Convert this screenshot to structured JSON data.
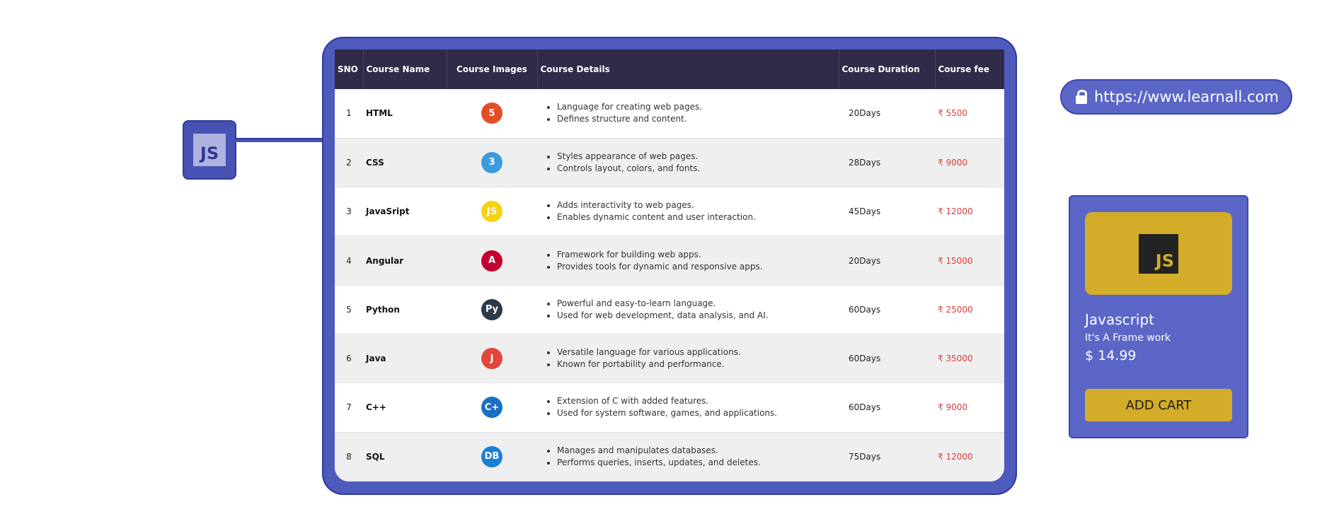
{
  "badge": {
    "label": "JS"
  },
  "table": {
    "headers": [
      "SNO",
      "Course Name",
      "Course Images",
      "Course Details",
      "Course Duration",
      "Course fee"
    ],
    "rows": [
      {
        "sno": "1",
        "name": "HTML",
        "icon": "html5-icon",
        "icon_color": "#e44d26",
        "icon_glyph": "5",
        "details": [
          "Language for creating web pages.",
          "Defines structure and content."
        ],
        "duration": "20Days",
        "fee": "₹ 5500"
      },
      {
        "sno": "2",
        "name": "CSS",
        "icon": "css3-icon",
        "icon_color": "#3c9bdc",
        "icon_glyph": "3",
        "details": [
          "Styles appearance of web pages.",
          "Controls layout, colors, and fonts."
        ],
        "duration": "28Days",
        "fee": "₹ 9000"
      },
      {
        "sno": "3",
        "name": "JavaSript",
        "icon": "javascript-icon",
        "icon_color": "#f5d216",
        "icon_glyph": "JS",
        "details": [
          "Adds interactivity to web pages.",
          "Enables dynamic content and user interaction."
        ],
        "duration": "45Days",
        "fee": "₹ 12000"
      },
      {
        "sno": "4",
        "name": "Angular",
        "icon": "angular-icon",
        "icon_color": "#c3002f",
        "icon_glyph": "A",
        "details": [
          "Framework for building web apps.",
          "Provides tools for dynamic and responsive apps."
        ],
        "duration": "20Days",
        "fee": "₹ 15000"
      },
      {
        "sno": "5",
        "name": "Python",
        "icon": "python-icon",
        "icon_color": "#2b3a4a",
        "icon_glyph": "Py",
        "details": [
          "Powerful and easy-to-learn language.",
          "Used for web development, data analysis, and AI."
        ],
        "duration": "60Days",
        "fee": "₹ 25000"
      },
      {
        "sno": "6",
        "name": "Java",
        "icon": "java-icon",
        "icon_color": "#e2463a",
        "icon_glyph": "J",
        "details": [
          "Versatile language for various applications.",
          "Known for portability and performance."
        ],
        "duration": "60Days",
        "fee": "₹ 35000"
      },
      {
        "sno": "7",
        "name": "C++",
        "icon": "cplusplus-icon",
        "icon_color": "#1b6ec2",
        "icon_glyph": "C+",
        "details": [
          "Extension of C with added features.",
          "Used for system software, games, and applications."
        ],
        "duration": "60Days",
        "fee": "₹ 9000"
      },
      {
        "sno": "8",
        "name": "SQL",
        "icon": "database-icon",
        "icon_color": "#1a7fd6",
        "icon_glyph": "DB",
        "details": [
          "Manages and manipulates databases.",
          "Performs queries, inserts, updates, and deletes."
        ],
        "duration": "75Days",
        "fee": "₹ 12000"
      }
    ]
  },
  "url_bar": {
    "url": "https://www.learnall.com"
  },
  "product_card": {
    "logo": "JS",
    "title": "Javascript",
    "subtitle": "It's A Frame work",
    "price": "$ 14.99",
    "button_label": "ADD CART"
  },
  "colors": {
    "accent": "#4f5abd",
    "header_bg": "#312a48",
    "gold": "#d3ac29",
    "fee_red": "#e03a3a"
  }
}
